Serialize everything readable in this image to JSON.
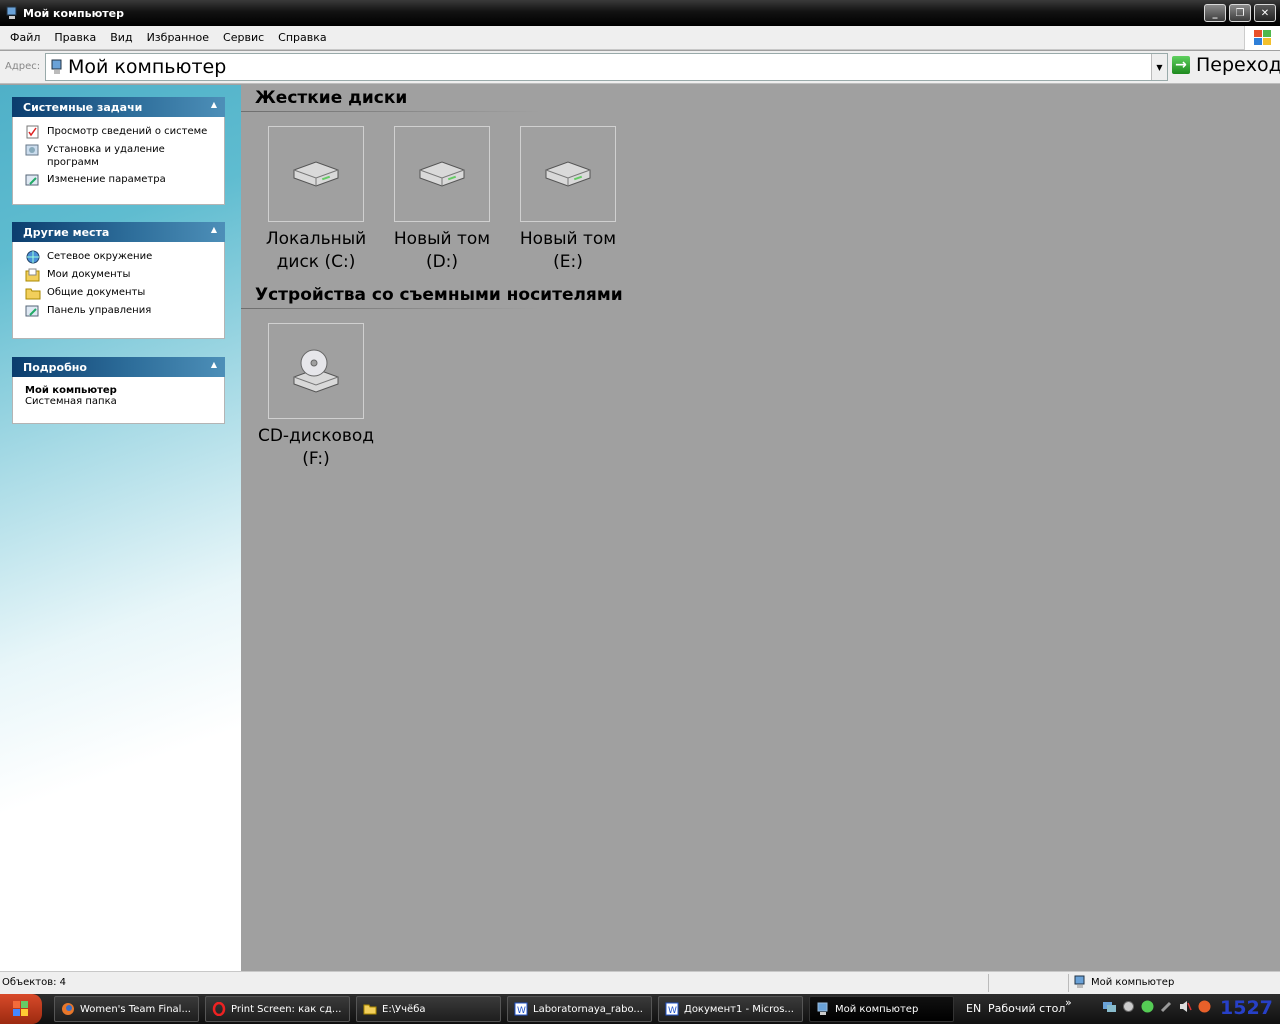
{
  "window": {
    "title": "Мой компьютер",
    "minimize": "_",
    "maximize": "❐",
    "close": "✕"
  },
  "menu": [
    "Файл",
    "Правка",
    "Вид",
    "Избранное",
    "Сервис",
    "Справка"
  ],
  "address": {
    "label": "Адрес:",
    "value": "Мой компьютер",
    "go_label": "Переход"
  },
  "sidebar": {
    "system_tasks": {
      "title": "Системные задачи",
      "items": [
        {
          "label": "Просмотр сведений о системе",
          "icon": "system-info-icon"
        },
        {
          "label": "Установка и удаление программ",
          "icon": "add-remove-programs-icon"
        },
        {
          "label": "Изменение параметра",
          "icon": "control-panel-icon"
        }
      ]
    },
    "other_places": {
      "title": "Другие места",
      "items": [
        {
          "label": "Сетевое окружение",
          "icon": "network-icon"
        },
        {
          "label": "Мои документы",
          "icon": "documents-icon"
        },
        {
          "label": "Общие документы",
          "icon": "folder-icon"
        },
        {
          "label": "Панель управления",
          "icon": "control-panel-icon"
        }
      ]
    },
    "details": {
      "title": "Подробно",
      "name": "Мой компьютер",
      "type": "Системная папка"
    }
  },
  "groups": [
    {
      "title": "Жесткие диски",
      "items": [
        {
          "line1": "Локальный",
          "line2": "диск (C:)",
          "icon": "hard-drive-icon"
        },
        {
          "line1": "Новый том",
          "line2": "(D:)",
          "icon": "hard-drive-icon"
        },
        {
          "line1": "Новый том",
          "line2": "(E:)",
          "icon": "hard-drive-icon"
        }
      ]
    },
    {
      "title": "Устройства со съемными носителями",
      "items": [
        {
          "line1": "CD-дисковод",
          "line2": "(F:)",
          "icon": "cd-drive-icon"
        }
      ]
    }
  ],
  "status": {
    "objects": "Объектов: 4",
    "location": "Мой компьютер"
  },
  "taskbar": {
    "buttons": [
      {
        "label": "Women's Team Final...",
        "icon": "firefox-icon",
        "active": false
      },
      {
        "label": "Print Screen: как сд...",
        "icon": "opera-icon",
        "active": false
      },
      {
        "label": "E:\\Учёба",
        "icon": "folder-icon",
        "active": false
      },
      {
        "label": "Laboratornaya_rabo...",
        "icon": "word-icon",
        "active": false
      },
      {
        "label": "Документ1 - Micros...",
        "icon": "word-icon",
        "active": false
      },
      {
        "label": "Мой компьютер",
        "icon": "computer-icon",
        "active": true
      }
    ],
    "lang": "EN",
    "desktop_toolbar": "Рабочий стол",
    "clock": "1527"
  },
  "colors": {
    "panel_header": "#0b3d6e",
    "clock": "#2740c8",
    "content_bg": "#a0a0a0"
  }
}
